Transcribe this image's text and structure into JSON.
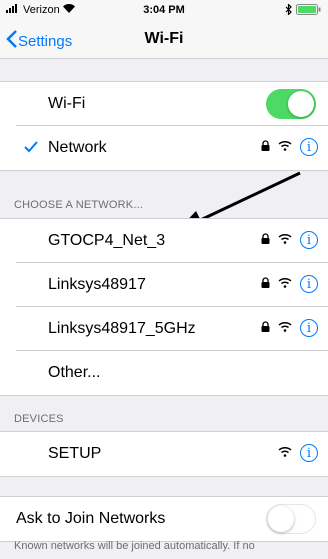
{
  "status_bar": {
    "carrier": "Verizon",
    "time": "3:04 PM"
  },
  "nav": {
    "back_label": "Settings",
    "title": "Wi-Fi"
  },
  "wifi_row": {
    "label": "Wi-Fi",
    "toggle_on": true
  },
  "current_network": {
    "label": "Network"
  },
  "choose_header": "CHOOSE A NETWORK...",
  "networks": [
    {
      "label": "GTOCP4_Net_3",
      "locked": true
    },
    {
      "label": "Linksys48917",
      "locked": true
    },
    {
      "label": "Linksys48917_5GHz",
      "locked": true
    },
    {
      "label": "Other..."
    }
  ],
  "devices_header": "DEVICES",
  "devices": [
    {
      "label": "SETUP"
    }
  ],
  "ask_join": {
    "label": "Ask to Join Networks",
    "toggle_on": false
  },
  "footer_text": "Known networks will be joined automatically. If no",
  "colors": {
    "accent": "#007aff",
    "toggle_on": "#4cd964",
    "background": "#efeff4"
  }
}
